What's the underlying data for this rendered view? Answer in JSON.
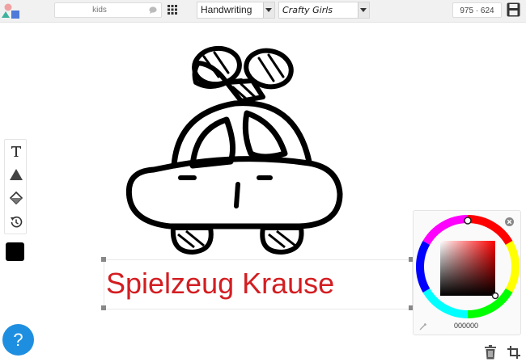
{
  "toolbar": {
    "search": {
      "placeholder": "kids",
      "value": ""
    },
    "font_family": "Handwriting",
    "font_name": "Crafty Girls",
    "canvas_size": "975 · 624"
  },
  "canvas": {
    "text_layer": "Spielzeug Krause",
    "text_color": "#d31e22",
    "art": "toy car with wind-up key"
  },
  "color_picker": {
    "hex_value": "000000"
  },
  "fill_swatch": "#000000",
  "help": {
    "label": "?"
  },
  "colors": {
    "accent": "#1e8fe0",
    "text_red": "#d31e22"
  }
}
